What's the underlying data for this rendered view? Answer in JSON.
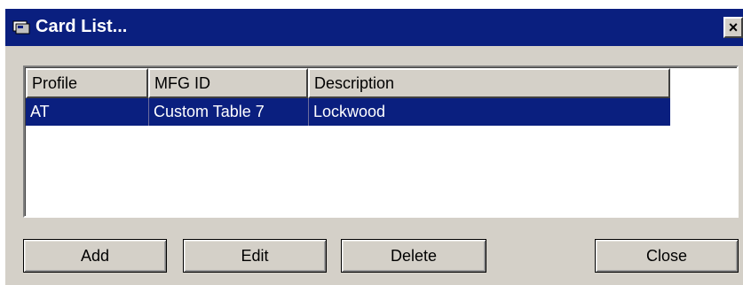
{
  "window": {
    "title": "Card List..."
  },
  "titlebar": {
    "close_glyph": "×",
    "icon": "window-app-icon"
  },
  "list": {
    "columns": [
      {
        "label": "Profile"
      },
      {
        "label": "MFG ID"
      },
      {
        "label": "Description"
      }
    ],
    "rows": [
      {
        "profile": "AT",
        "mfg_id": "Custom Table 7",
        "description": "Lockwood",
        "selected": true
      }
    ]
  },
  "buttons": {
    "add": "Add",
    "edit": "Edit",
    "delete": "Delete",
    "close": "Close"
  },
  "colors": {
    "title_bar": "#0a1f7f",
    "selection": "#0a1f7f",
    "face": "#d4d0c8"
  }
}
